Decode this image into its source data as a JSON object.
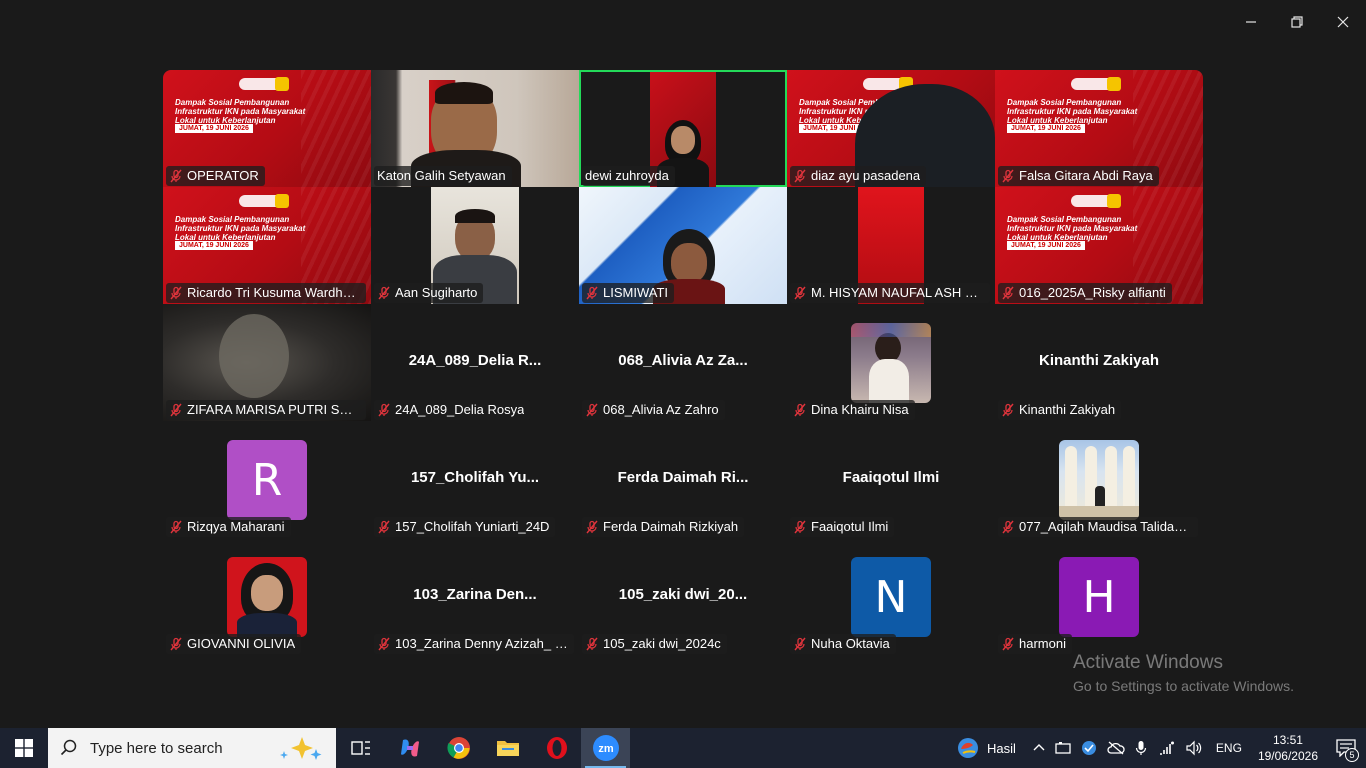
{
  "window": {
    "controls": {
      "minimize": "minimize",
      "restore": "restore",
      "close": "close"
    }
  },
  "tiles": [
    {
      "name": "OPERATOR",
      "type": "slide"
    },
    {
      "name": "Katon Galih Setyawan",
      "type": "camera"
    },
    {
      "name": "dewi zuhroyda",
      "type": "camera",
      "active": true
    },
    {
      "name": "diaz ayu pasadena",
      "type": "camera"
    },
    {
      "name": "Falsa Gitara Abdi Raya",
      "type": "slide"
    },
    {
      "name": "Ricardo Tri Kusuma Wardhan...",
      "type": "slide"
    },
    {
      "name": "Aan Sugiharto",
      "type": "camera"
    },
    {
      "name": "LISMIWATI",
      "type": "camera"
    },
    {
      "name": "M. HISYAM NAUFAL ASH SHID...",
      "type": "camera"
    },
    {
      "name": "016_2025A_Risky alfianti",
      "type": "slide"
    },
    {
      "name": "ZIFARA MARISA PUTRI SETYA...",
      "type": "camera"
    },
    {
      "name": "24A_089_Delia Rosya",
      "type": "text",
      "display": "24A_089_Delia R..."
    },
    {
      "name": "068_Alivia Az Zahro",
      "type": "text",
      "display": "068_Alivia Az Za..."
    },
    {
      "name": "Dina Khairu Nisa",
      "type": "photo"
    },
    {
      "name": "Kinanthi Zakiyah",
      "type": "text",
      "display": "Kinanthi Zakiyah"
    },
    {
      "name": "Rizqya Maharani",
      "type": "avatar",
      "initial": "R",
      "color": "#b04fc6"
    },
    {
      "name": "157_Cholifah Yuniarti_24D",
      "type": "text",
      "display": "157_Cholifah  Yu..."
    },
    {
      "name": "Ferda Daimah Rizkiyah",
      "type": "text",
      "display": "Ferda  Daimah Ri..."
    },
    {
      "name": "Faaiqotul Ilmi",
      "type": "text",
      "display": "Faaiqotul Ilmi"
    },
    {
      "name": "077_Aqilah Maudisa Talidah M",
      "type": "photo"
    },
    {
      "name": "GIOVANNI OLIVIA",
      "type": "photo"
    },
    {
      "name": "103_Zarina Denny Azizah_ 25i",
      "type": "text",
      "display": "103_Zarina  Den..."
    },
    {
      "name": "105_zaki dwi_2024c",
      "type": "text",
      "display": "105_zaki  dwi_20..."
    },
    {
      "name": "Nuha Oktavia",
      "type": "avatar",
      "initial": "N",
      "color": "#0e5aa7"
    },
    {
      "name": "harmoni",
      "type": "avatar",
      "initial": "H",
      "color": "#8a1ab4"
    }
  ],
  "watermark": {
    "line1": "Activate Windows",
    "line2": "Go to Settings to activate Windows."
  },
  "taskbar": {
    "search_placeholder": "Type here to search",
    "weather_label": "Hasil",
    "language": "ENG",
    "time": "13:51",
    "date": "19/06/2026",
    "notifications": "5"
  }
}
